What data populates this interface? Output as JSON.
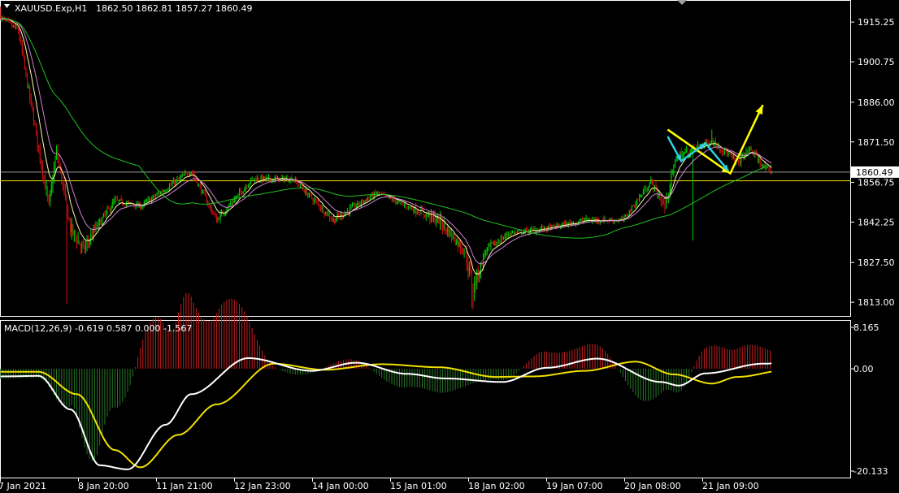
{
  "header": {
    "symbol": "XAUUSD.Exp,H1",
    "ohlc": "1862.50 1862.81 1857.27 1860.49"
  },
  "macd_header": {
    "label": "MACD(12,26,9) -0.619 0.587 0.000 -1.567"
  },
  "price_axis_labels": [
    "1915.25",
    "1900.75",
    "1886.00",
    "1871.50",
    "1856.75",
    "1842.25",
    "1827.50",
    "1813.00"
  ],
  "current_price_label": "1860.49",
  "macd_axis_labels": [
    "8.165",
    "0.00",
    "-20.133"
  ],
  "time_axis_labels": [
    "7 Jan 2021",
    "8 Jan 20:00",
    "11 Jan 21:00",
    "12 Jan 23:00",
    "14 Jan 00:00",
    "15 Jan 01:00",
    "18 Jan 02:00",
    "19 Jan 07:00",
    "20 Jan 08:00",
    "21 Jan 09:00"
  ],
  "colors": {
    "background": "#000000",
    "bull_candle": "#00d000",
    "bear_candle": "#d01010",
    "ma_fast": "#fffab0",
    "ma_mid": "#d080d8",
    "ma_slow": "#20c020",
    "macd_line": "#ffffff",
    "signal_line": "#f0e000",
    "hist_pos": "#c81e1e",
    "hist_neg": "#287828",
    "annotation_yellow": "#ffff00",
    "annotation_cyan": "#30d0e0",
    "price_line": "#c0c0c0",
    "level_line": "#f0e000"
  },
  "chart_data": {
    "type": "candlestick",
    "instrument": "XAUUSD.Exp",
    "timeframe": "H1",
    "ylim": [
      1808,
      1923
    ],
    "current_price": 1860.49,
    "horizontal_level": 1857.3,
    "anchors": [
      [
        0,
        1917,
        1,
        0.7,
        0.8
      ],
      [
        14,
        1912,
        -1,
        1.6,
        1.3
      ],
      [
        22,
        1890,
        -1,
        1.6,
        1.3
      ],
      [
        38,
        1848,
        -1,
        2.0,
        2.2
      ],
      [
        44,
        1868,
        1,
        1.8,
        1.8
      ],
      [
        55,
        1840,
        -1,
        2.0,
        2.6
      ],
      [
        65,
        1832,
        -1,
        2.0,
        2.0
      ],
      [
        75,
        1840,
        1,
        1.6,
        1.3
      ],
      [
        90,
        1850,
        1,
        1.0,
        1.0
      ],
      [
        110,
        1848,
        1,
        0.8,
        0.8
      ],
      [
        150,
        1861,
        1,
        1.0,
        0.9
      ],
      [
        170,
        1843,
        -1,
        1.0,
        1.0
      ],
      [
        198,
        1858,
        1,
        0.9,
        0.9
      ],
      [
        230,
        1858,
        -1,
        0.8,
        0.8
      ],
      [
        262,
        1843,
        -1,
        1.2,
        1.0
      ],
      [
        296,
        1853,
        1,
        0.7,
        0.8
      ],
      [
        320,
        1848,
        -1,
        0.8,
        0.8
      ],
      [
        345,
        1843,
        -1,
        1.6,
        1.8
      ],
      [
        365,
        1832,
        -1,
        1.8,
        1.8
      ],
      [
        372,
        1818,
        -1,
        2.6,
        2.8
      ],
      [
        382,
        1832,
        1,
        1.6,
        1.3
      ],
      [
        400,
        1838,
        1,
        0.9,
        0.9
      ],
      [
        430,
        1840,
        1,
        0.8,
        0.8
      ],
      [
        460,
        1843,
        1,
        0.8,
        0.8
      ],
      [
        490,
        1843,
        1,
        0.8,
        0.7
      ],
      [
        512,
        1857,
        1,
        1.0,
        1.0
      ],
      [
        523,
        1848,
        -1,
        1.6,
        1.8
      ],
      [
        532,
        1866,
        1,
        1.6,
        1.3
      ],
      [
        560,
        1872,
        1,
        1.0,
        1.0
      ],
      [
        580,
        1864,
        -1,
        1.3,
        1.3
      ],
      [
        590,
        1869,
        1,
        0.9,
        0.9
      ],
      [
        603,
        1861,
        -1,
        1.2,
        1.0
      ],
      [
        607,
        1860.5,
        -1,
        0.6,
        0.6
      ]
    ],
    "annotations": {
      "yellow_path": [
        [
          0.7853,
          1876.0
        ],
        [
          0.8589,
          1860.0
        ],
        [
          0.8972,
          1885.0
        ]
      ],
      "cyan_path": [
        [
          0.7853,
          1873.5
        ],
        [
          0.8012,
          1864.5
        ],
        [
          0.8298,
          1871.0
        ],
        [
          0.8566,
          1861.0
        ]
      ]
    },
    "macd": {
      "params": "12,26,9",
      "main": -0.619,
      "signal": 0.587,
      "ylim": [
        -20.133,
        8.165
      ],
      "main_anchors": [
        [
          0,
          -1.5
        ],
        [
          30,
          -1.4
        ],
        [
          55,
          -8
        ],
        [
          78,
          -19
        ],
        [
          100,
          -19.8
        ],
        [
          130,
          -11
        ],
        [
          150,
          -5
        ],
        [
          195,
          2.1
        ],
        [
          245,
          -0.4
        ],
        [
          280,
          1.2
        ],
        [
          320,
          -1.0
        ],
        [
          350,
          -1.9
        ],
        [
          395,
          -2.6
        ],
        [
          430,
          0.2
        ],
        [
          470,
          2.0
        ],
        [
          520,
          -2.6
        ],
        [
          534,
          -3.3
        ],
        [
          555,
          -0.9
        ],
        [
          600,
          1.0
        ],
        [
          650,
          2.4
        ],
        [
          690,
          3.0
        ],
        [
          735,
          5.2
        ],
        [
          760,
          7.8
        ],
        [
          790,
          6.8
        ],
        [
          820,
          8.1
        ],
        [
          850,
          6.5
        ],
        [
          878,
          2.5
        ],
        [
          902,
          1.6
        ],
        [
          916,
          0.8
        ],
        [
          932,
          -0.6
        ]
      ],
      "signal_anchors": [
        [
          0,
          -0.6
        ],
        [
          30,
          -0.6
        ],
        [
          60,
          -5
        ],
        [
          90,
          -16
        ],
        [
          110,
          -19.4
        ],
        [
          140,
          -13
        ],
        [
          170,
          -7
        ],
        [
          215,
          1.0
        ],
        [
          255,
          -0.2
        ],
        [
          300,
          0.9
        ],
        [
          345,
          0.3
        ],
        [
          390,
          -1.6
        ],
        [
          420,
          -1.5
        ],
        [
          460,
          -0.4
        ],
        [
          500,
          1.4
        ],
        [
          530,
          -1.1
        ],
        [
          560,
          -2.9
        ],
        [
          580,
          -1.6
        ],
        [
          620,
          -0.2
        ],
        [
          660,
          1.3
        ],
        [
          720,
          2.6
        ],
        [
          770,
          4.0
        ],
        [
          800,
          6.5
        ],
        [
          830,
          7.4
        ],
        [
          860,
          6.0
        ],
        [
          890,
          2.5
        ],
        [
          925,
          1.3
        ],
        [
          932,
          0.6
        ]
      ]
    }
  }
}
